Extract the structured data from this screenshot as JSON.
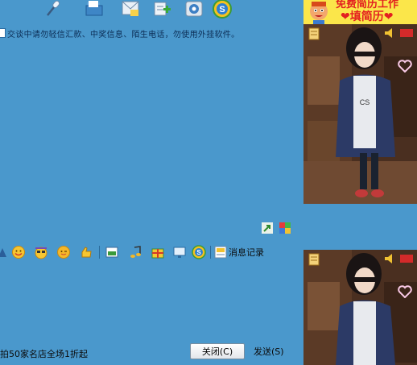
{
  "toolbar_top": {
    "icons": [
      "microphone-icon",
      "folder-icon",
      "email-icon",
      "add-contact-icon",
      "settings-icon",
      "s-logo-icon"
    ]
  },
  "notice": {
    "text": "交谈中请勿轻信汇款、中奖信息、陌生电话，勿使用外挂软件。"
  },
  "input_toolbar": {
    "icons": [
      "smiley-icon",
      "magic-face-icon",
      "wink-icon",
      "thumb-icon",
      "screenshot-icon",
      "music-icon",
      "gift-icon",
      "screen-share-icon",
      "s-logo-icon",
      "history-icon"
    ],
    "history_label": "消息记录"
  },
  "footer": {
    "ad_text": "拍50家名店全场1折起",
    "close_label": "关闭(C)",
    "send_label": "发送(S)"
  },
  "sidebar": {
    "banner_line1": "免费简历工作",
    "banner_line2": "❤填简历❤",
    "accent": "#fbe64a"
  },
  "colors": {
    "background": "#4a98cc",
    "text": "#0c2e56"
  }
}
